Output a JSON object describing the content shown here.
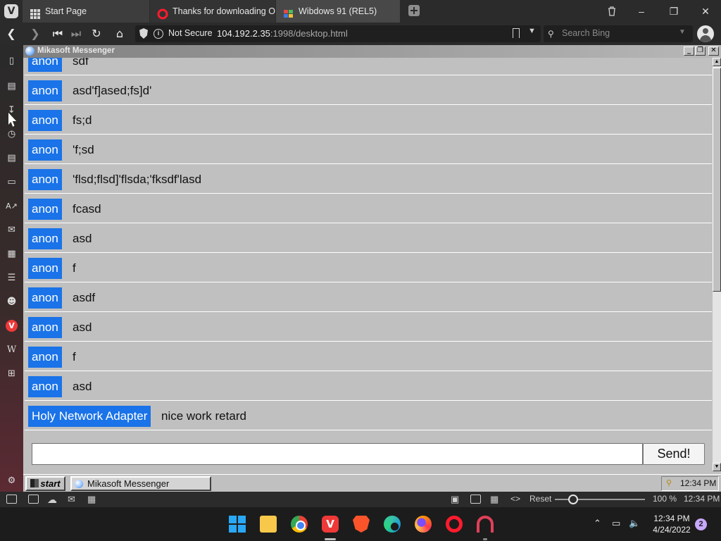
{
  "browser": {
    "tabs": [
      {
        "label": "Start Page",
        "icon": "grid-icon"
      },
      {
        "label": "Thanks for downloading Op",
        "icon": "opera-favicon"
      },
      {
        "label": "Wibdows 91 (REL5)",
        "icon": "windows91-favicon"
      }
    ],
    "address": {
      "security_label": "Not Secure",
      "url_host": "104.192.2.35",
      "url_rest": ":1998/desktop.html"
    },
    "search": {
      "placeholder": "Search Bing"
    },
    "status": {
      "reset_label": "Reset",
      "zoom_level": "100 %",
      "zoom_fraction": 0.2,
      "time": "12:34 PM"
    }
  },
  "messenger": {
    "window_title": "Mikasoft Messenger",
    "messages": [
      {
        "author": "anon",
        "text": "sdf"
      },
      {
        "author": "anon",
        "text": "asd'f]ased;fs]d'"
      },
      {
        "author": "anon",
        "text": "fs;d"
      },
      {
        "author": "anon",
        "text": "'f;sd"
      },
      {
        "author": "anon",
        "text": "'flsd;flsd]'flsda;'fksdf'lasd"
      },
      {
        "author": "anon",
        "text": "fcasd"
      },
      {
        "author": "anon",
        "text": "asd"
      },
      {
        "author": "anon",
        "text": "f"
      },
      {
        "author": "anon",
        "text": "asdf"
      },
      {
        "author": "anon",
        "text": "asd"
      },
      {
        "author": "anon",
        "text": "f"
      },
      {
        "author": "anon",
        "text": "asd"
      },
      {
        "author": "Holy Network Adapter",
        "text": "nice work retard"
      }
    ],
    "input_value": "",
    "send_label": "Send!"
  },
  "win91_taskbar": {
    "start_label": "start",
    "task_label": "Mikasoft Messenger",
    "tray_time": "12:34 PM"
  },
  "windows_taskbar": {
    "apps": [
      "windows-start",
      "file-explorer",
      "chrome",
      "vivaldi",
      "brave",
      "edge",
      "firefox",
      "opera",
      "arc"
    ],
    "clock_time": "12:34 PM",
    "clock_date": "4/24/2022",
    "notification_count": "2"
  }
}
